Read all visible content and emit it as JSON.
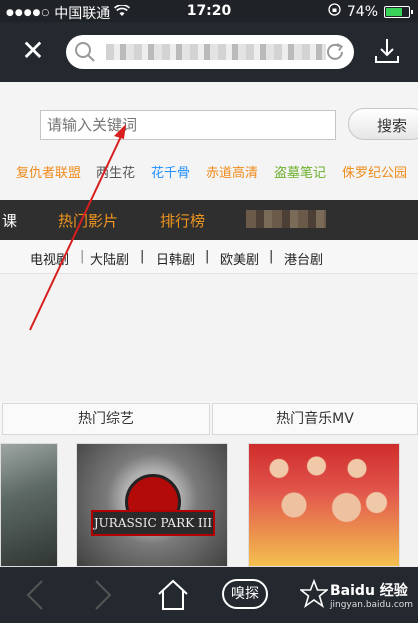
{
  "status_bar": {
    "carrier": "中国联通",
    "time": "17:20",
    "battery_text": "74%",
    "battery_level": 0.74
  },
  "search": {
    "placeholder": "请输入关键词",
    "button_label": "搜索"
  },
  "quick_links": [
    {
      "label": "复仇者联盟",
      "color": "#f08a19"
    },
    {
      "label": "两生花",
      "color": "#555555"
    },
    {
      "label": "花千骨",
      "color": "#1e90ff"
    },
    {
      "label": "赤道高清",
      "color": "#f08a19"
    },
    {
      "label": "盗墓笔记",
      "color": "#6cae2c"
    },
    {
      "label": "侏罗纪公园",
      "color": "#f08a19"
    }
  ],
  "category_bar": {
    "items": [
      "课",
      "热门影片",
      "排行榜"
    ]
  },
  "sub_categories": [
    "电视剧",
    "|",
    "大陆剧",
    "|",
    "日韩剧",
    "|",
    "欧美剧",
    "|",
    "港台剧"
  ],
  "section_tabs": [
    "热门综艺",
    "热门音乐MV"
  ],
  "posters": [
    {
      "title": ""
    },
    {
      "title": "JURASSIC PARK III"
    },
    {
      "title": ""
    }
  ],
  "bottom_bar": {
    "sniff_label": "嗅探"
  },
  "watermark": {
    "brand": "Baidu 经验",
    "url": "jingyan.baidu.com"
  },
  "colors": {
    "nav_bg": "#24292f",
    "accent_orange": "#f0961e"
  }
}
